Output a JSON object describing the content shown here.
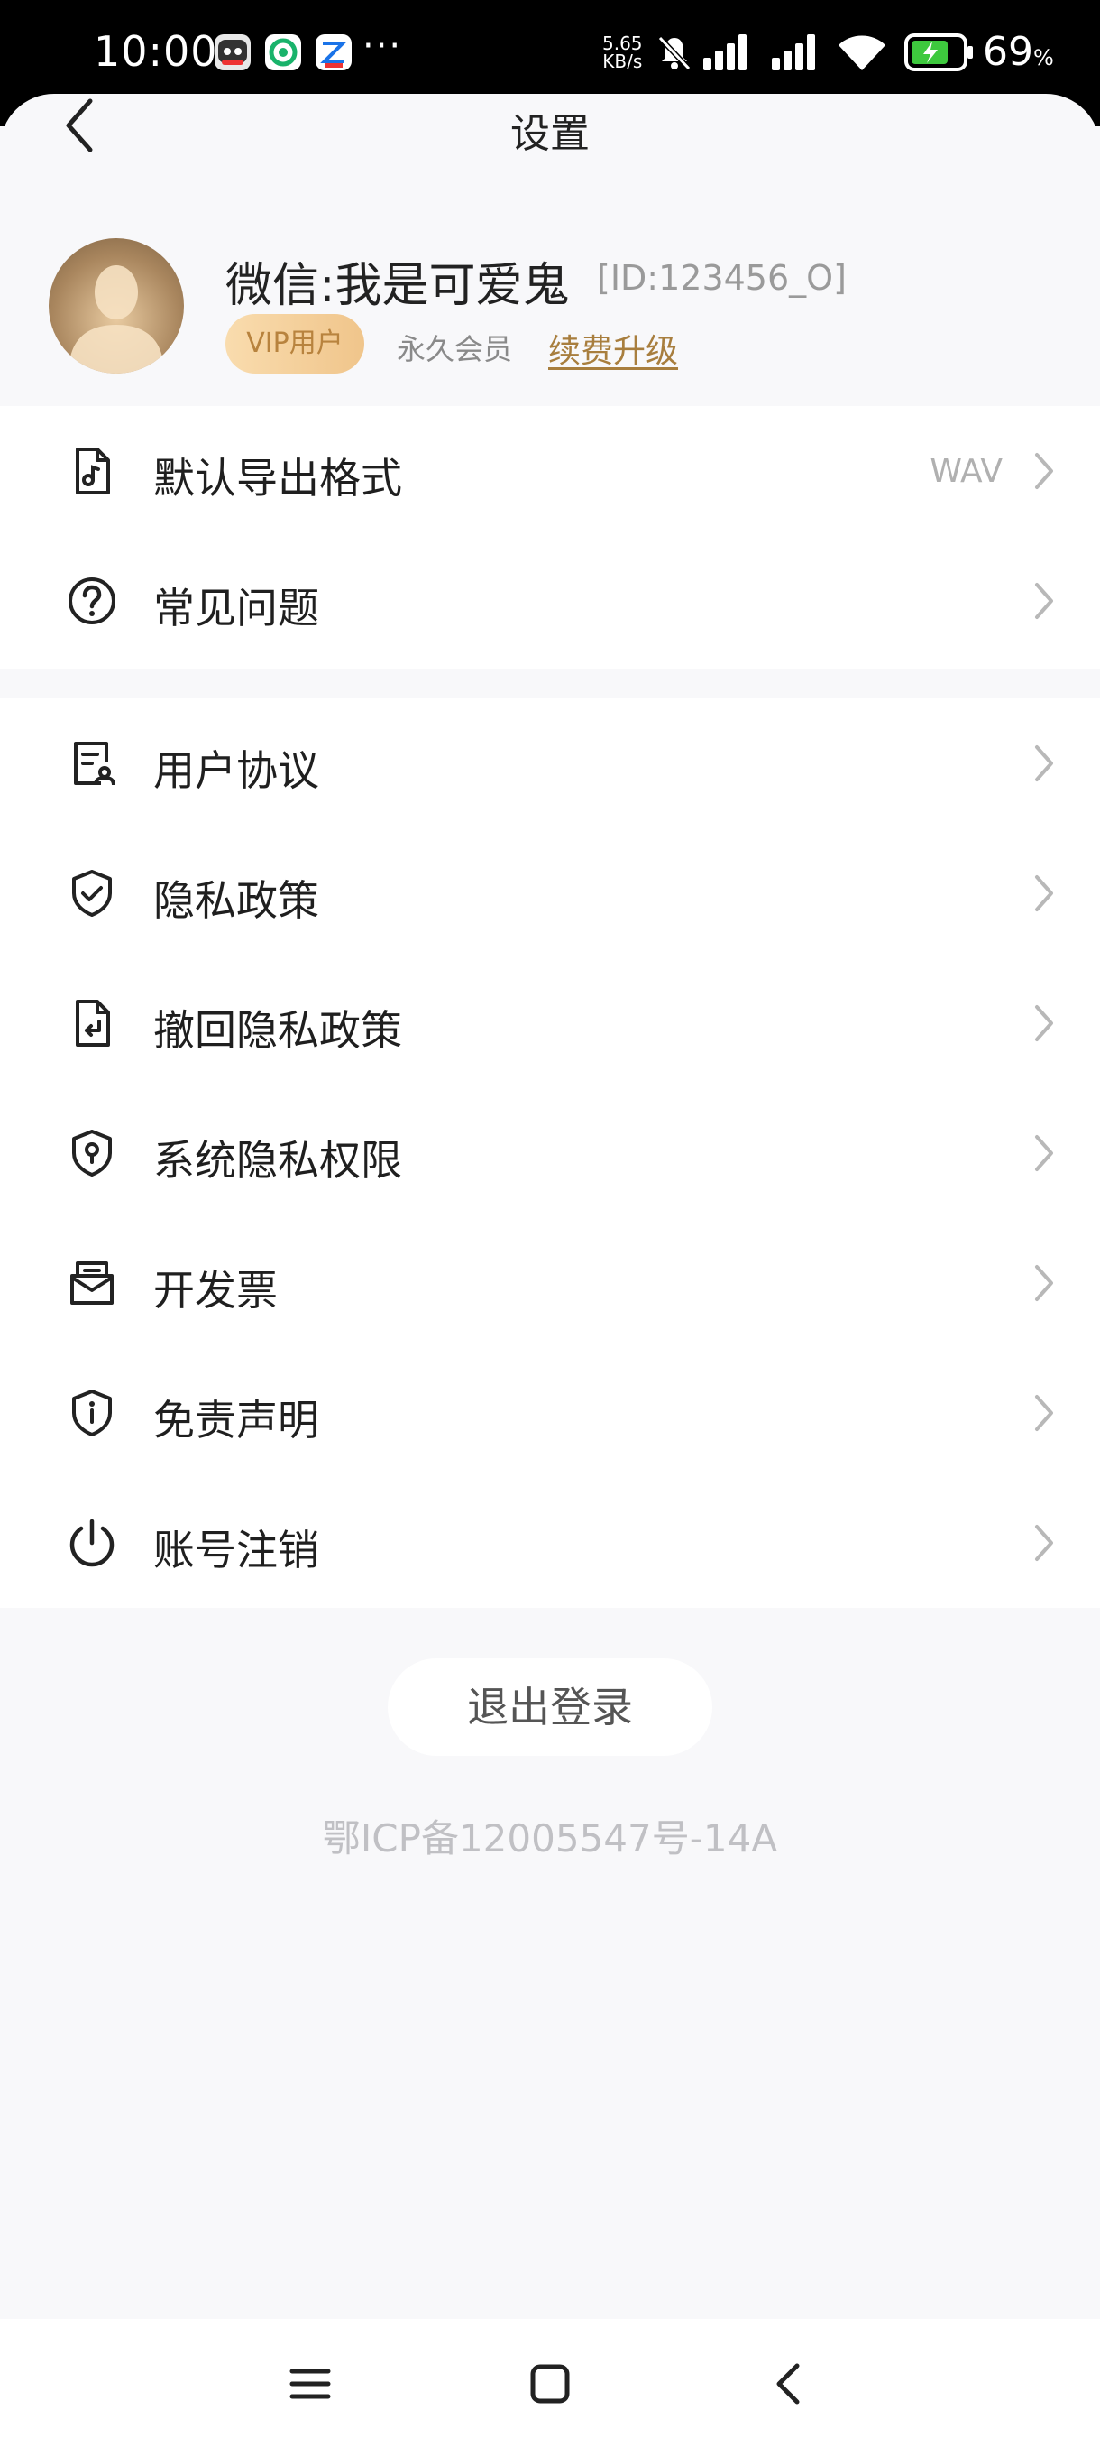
{
  "status_bar": {
    "time": "10:00",
    "more_indicator": "···",
    "net_speed_value": "5.65",
    "net_speed_unit": "KB/s",
    "battery_percent": "69",
    "battery_percent_sign": "%"
  },
  "header": {
    "title": "设置",
    "back_icon": "chevron-left-icon"
  },
  "profile": {
    "name": "微信:我是可爱鬼",
    "id": "[ID:123456_O]",
    "vip_badge": "VIP用户",
    "member_type": "永久会员",
    "renew_link": "续费升级"
  },
  "section1": {
    "items": [
      {
        "label": "默认导出格式",
        "value": "WAV",
        "icon": "music-file-icon"
      },
      {
        "label": "常见问题",
        "icon": "question-circle-icon"
      }
    ]
  },
  "section2": {
    "items": [
      {
        "label": "用户协议",
        "icon": "agreement-icon"
      },
      {
        "label": "隐私政策",
        "icon": "shield-check-icon"
      },
      {
        "label": "撤回隐私政策",
        "icon": "file-return-icon"
      },
      {
        "label": "系统隐私权限",
        "icon": "shield-keyhole-icon"
      },
      {
        "label": "开发票",
        "icon": "invoice-icon"
      },
      {
        "label": "免责声明",
        "icon": "shield-info-icon"
      },
      {
        "label": "账号注销",
        "icon": "power-icon"
      }
    ]
  },
  "logout": {
    "label": "退出登录"
  },
  "footer": {
    "icp": "鄂ICP备12005547号-14A"
  },
  "colors": {
    "accent_gold": "#a87e3e",
    "vip_gradient_start": "#f9dcae",
    "vip_gradient_end": "#f0c58b",
    "page_background": "#f8f8fa"
  }
}
